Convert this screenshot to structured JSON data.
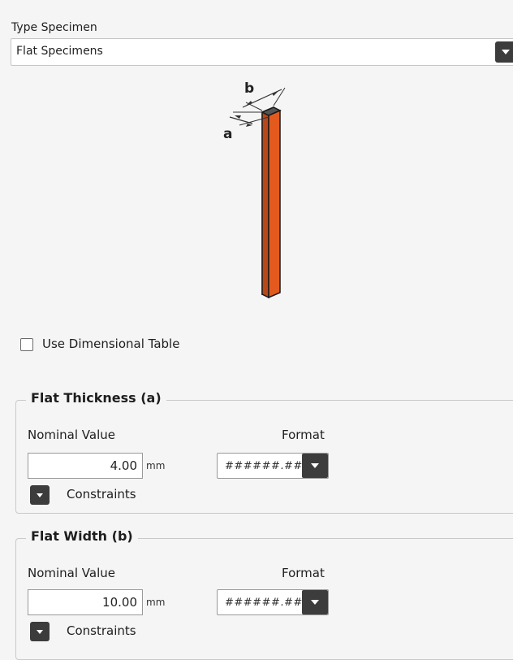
{
  "type_specimen": {
    "label": "Type Specimen",
    "value": "Flat Specimens"
  },
  "illustration": {
    "label_b": "b",
    "label_a": "a",
    "specimen_color": "#f26b2c",
    "specimen_edge_color": "#1a1a1a"
  },
  "use_dimensional_table": {
    "label": "Use Dimensional Table",
    "checked": false
  },
  "flat_thickness": {
    "title": "Flat Thickness (a)",
    "nominal_label": "Nominal Value",
    "value": "4.00",
    "unit": "mm",
    "format_label": "Format",
    "format_value": "######.##",
    "constraints_label": "Constraints"
  },
  "flat_width": {
    "title": "Flat Width (b)",
    "nominal_label": "Nominal Value",
    "value": "10.00",
    "unit": "mm",
    "format_label": "Format",
    "format_value": "######.##",
    "constraints_label": "Constraints"
  },
  "icons": {
    "dropdown": "chevron-down-icon",
    "checkbox": "checkbox-unchecked-icon"
  }
}
